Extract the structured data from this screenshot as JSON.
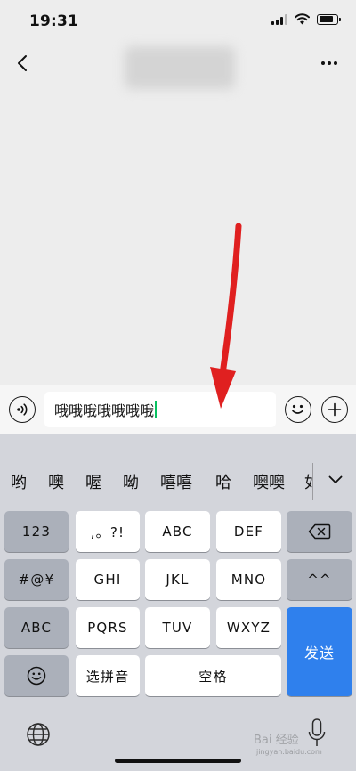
{
  "status_bar": {
    "time": "19:31"
  },
  "nav": {
    "title": ""
  },
  "input": {
    "text": "哦哦哦哦哦哦哦"
  },
  "candidates": [
    "哟",
    "噢",
    "喔",
    "呦",
    "嘻嘻",
    "哈",
    "噢噢",
    "如"
  ],
  "keys": {
    "num": "123",
    "punct": ",。?!",
    "abc_row1": "ABC",
    "def": "DEF",
    "symbols": "#@¥",
    "ghi": "GHI",
    "jkl": "JKL",
    "mno": "MNO",
    "smile_key": "^^",
    "abc_switch": "ABC",
    "pqrs": "PQRS",
    "tuv": "TUV",
    "wxyz": "WXYZ",
    "send": "发送",
    "select_pinyin": "选拼音",
    "space": "空格"
  },
  "watermark": {
    "text": "Bai 经验",
    "sub": "jingyan.baidu.com"
  },
  "colors": {
    "send_key": "#2f80ed",
    "arrow": "#e02020",
    "caret": "#07c160"
  }
}
